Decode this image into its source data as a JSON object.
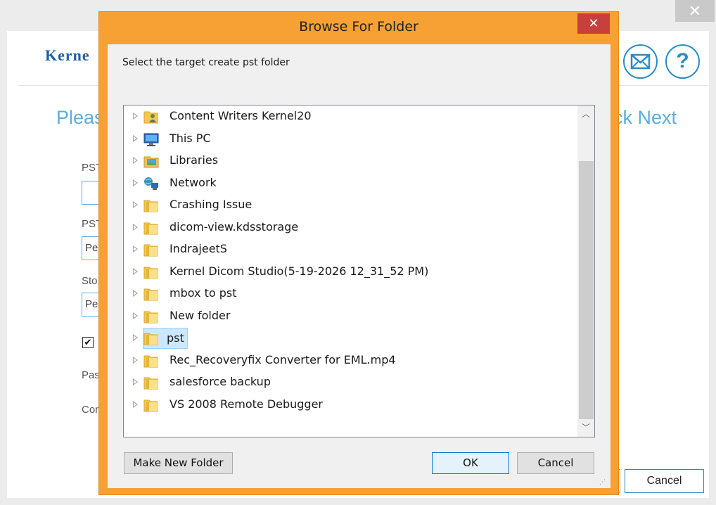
{
  "app": {
    "brand": "Kerne",
    "instruction_left": "Pleas",
    "instruction_right": "ick Next",
    "labels": [
      "PST",
      "PST",
      "Sto",
      "Pas",
      "Con"
    ],
    "field_values": [
      "",
      "Pe",
      "Pe"
    ],
    "checkbox_checked": true,
    "cancel_label": "Cancel"
  },
  "dialog": {
    "title": "Browse For Folder",
    "close_glyph": "✕",
    "description": "Select the target create pst folder",
    "tree_items": [
      {
        "label": "Content Writers Kernel20",
        "icon": "user-folder-icon"
      },
      {
        "label": "This PC",
        "icon": "computer-icon"
      },
      {
        "label": "Libraries",
        "icon": "libraries-icon"
      },
      {
        "label": "Network",
        "icon": "network-icon"
      },
      {
        "label": "Crashing Issue",
        "icon": "folder-icon"
      },
      {
        "label": "dicom-view.kdsstorage",
        "icon": "folder-icon"
      },
      {
        "label": "IndrajeetS",
        "icon": "folder-icon"
      },
      {
        "label": "Kernel Dicom Studio(5-19-2026 12_31_52 PM)",
        "icon": "folder-icon"
      },
      {
        "label": "mbox to pst",
        "icon": "folder-icon"
      },
      {
        "label": "New folder",
        "icon": "folder-icon"
      },
      {
        "label": "pst",
        "icon": "folder-icon",
        "selected": true
      },
      {
        "label": "Rec_Recoveryfix Converter for EML.mp4",
        "icon": "folder-icon"
      },
      {
        "label": "salesforce backup",
        "icon": "folder-icon"
      },
      {
        "label": "VS 2008 Remote Debugger",
        "icon": "folder-icon"
      }
    ],
    "buttons": {
      "make_new_folder": "Make New Folder",
      "ok": "OK",
      "cancel": "Cancel"
    }
  },
  "colors": {
    "dialog_frame": "#f7a034",
    "close_button": "#c7403d",
    "selection": "#cce8ff",
    "accent": "#2a8cc8"
  }
}
